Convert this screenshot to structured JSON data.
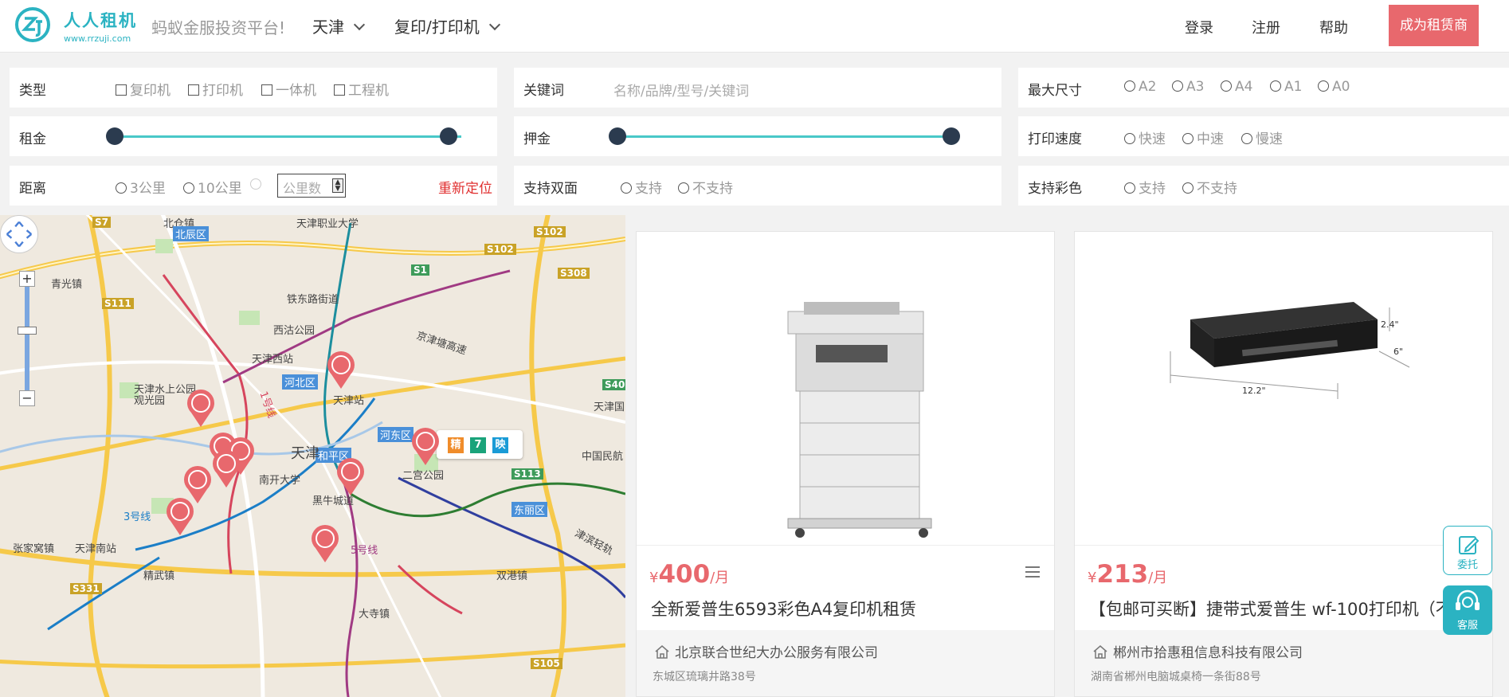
{
  "header": {
    "brand_name": "人人租机",
    "brand_url": "www.rrzuji.com",
    "slogan": "蚂蚁金服投资平台!",
    "city": "天津",
    "category": "复印/打印机",
    "login": "登录",
    "register": "注册",
    "help": "帮助",
    "become_vendor": "成为租赁商",
    "accent_color": "#e8686d",
    "brand_color": "#2bb3c2"
  },
  "filters": {
    "type": {
      "label": "类型",
      "options": [
        "复印机",
        "打印机",
        "一体机",
        "工程机"
      ]
    },
    "keyword": {
      "label": "关键词",
      "placeholder": "名称/品牌/型号/关键词"
    },
    "max_size": {
      "label": "最大尺寸",
      "options": [
        "A2",
        "A3",
        "A4",
        "A1",
        "A0"
      ]
    },
    "rent": {
      "label": "租金"
    },
    "deposit": {
      "label": "押金"
    },
    "print_speed": {
      "label": "打印速度",
      "options": [
        "快速",
        "中速",
        "慢速"
      ]
    },
    "distance": {
      "label": "距离",
      "options": [
        "3公里",
        "10公里"
      ],
      "custom_placeholder": "公里数",
      "relocate": "重新定位"
    },
    "duplex": {
      "label": "支持双面",
      "options": [
        "支持",
        "不支持"
      ]
    },
    "color": {
      "label": "支持彩色",
      "options": [
        "支持",
        "不支持"
      ]
    }
  },
  "map": {
    "labels": {
      "beichenzhen": "北仓镇",
      "beichenqu": "北辰区",
      "zhiye": "天津职业大学",
      "qingguangzhen": "青光镇",
      "tiedongjie": "铁东路街道",
      "xigu": "西沽公园",
      "tianjinxi": "天津西站",
      "hebei": "河北区",
      "tianjinzhan": "天津站",
      "jingjin": "京津塘高速",
      "hedong": "河东区",
      "heping": "和平区",
      "ergong": "二宫公园",
      "nankai": "南开大学",
      "tianjin": "天津",
      "dongli": "东丽区",
      "zhangjiawo": "张家窝镇",
      "tianjinnan": "天津南站",
      "jinggu": "精武镇",
      "shuanggang": "双港镇",
      "dasi": "大寺镇",
      "minhang": "中国民航",
      "tianjinguoji": "天津国际机",
      "shuishang": "天津水上公园",
      "guanyuan": "观光园",
      "binhai": "津滨轻轨",
      "line1": "1号线",
      "line3": "3号线",
      "line5": "5号线",
      "heiniu": "黑牛城道"
    },
    "road_signs": [
      "S7",
      "S102",
      "S102",
      "S308",
      "S1",
      "S111",
      "S40",
      "S113",
      "S331",
      "S105"
    ],
    "popup_tags": [
      "精",
      "7",
      "映"
    ]
  },
  "products": [
    {
      "currency": "¥",
      "price": "400",
      "unit": "/月",
      "title": "全新爱普生6593彩色A4复印机租赁",
      "seller": "北京联合世纪大办公服务有限公司",
      "address": "东城区琉璃井路38号"
    },
    {
      "currency": "¥",
      "price": "213",
      "unit": "/月",
      "title": "【包邮可买断】捷带式爱普生 wf-100打印机（不",
      "seller": "郴州市拾惠租信息科技有限公司",
      "address": "湖南省郴州电脑城桌椅一条街88号",
      "dims": {
        "h": "2.4\"",
        "d": "6\"",
        "w": "12.2\""
      }
    }
  ],
  "float": {
    "entrust": "委托",
    "service": "客服",
    "color": "#2bb3c2"
  }
}
